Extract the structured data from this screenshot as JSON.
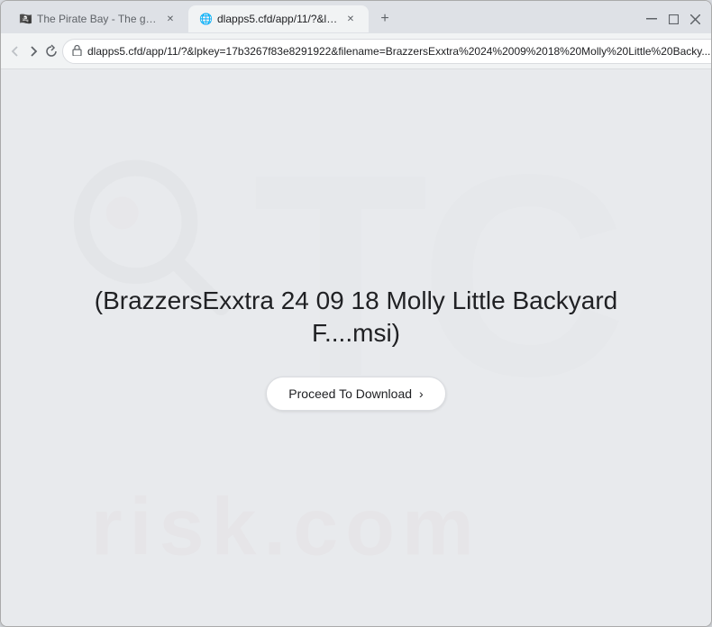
{
  "browser": {
    "tabs": [
      {
        "id": "tab-1",
        "title": "The Pirate Bay - The galaxy's m...",
        "favicon": "🏴",
        "active": false
      },
      {
        "id": "tab-2",
        "title": "dlapps5.cfd/app/11/?&lpkey=...",
        "favicon": "🌐",
        "active": true
      }
    ],
    "new_tab_label": "+",
    "address": "dlapps5.cfd/app/11/?&lpkey=17b3267f83e8291922&filename=BrazzersExxtra%2024%2009%2018%20Molly%20Little%20Backy...",
    "window_controls": {
      "minimize": "—",
      "maximize": "□",
      "close": "✕"
    }
  },
  "page": {
    "file_title": "(BrazzersExxtra 24 09 18 Molly Little Backyard F....msi)",
    "download_button_label": "Proceed To Download",
    "download_button_icon": "›"
  },
  "watermark": {
    "text": "risk.com"
  }
}
